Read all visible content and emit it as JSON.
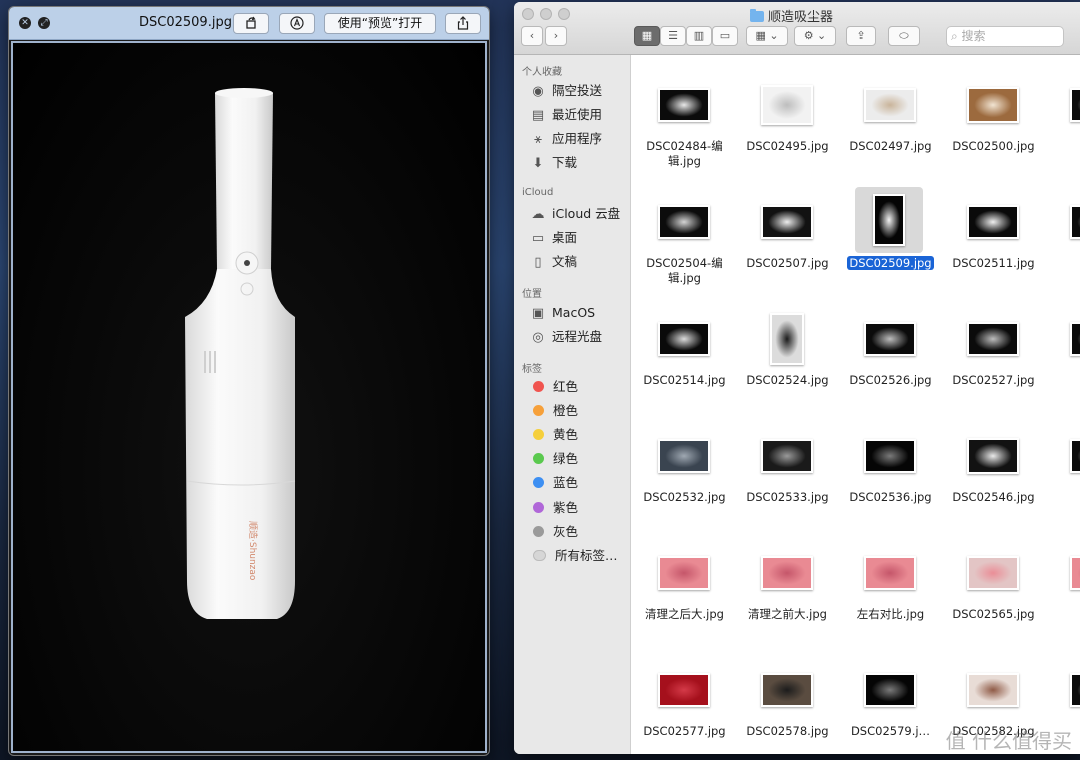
{
  "quicklook": {
    "filename": "DSC02509.jpg",
    "open_with_label": "使用“预览”打开",
    "product": {
      "brand_text": "顺造·Shunzao",
      "colors": {
        "body": "#f4f4f4",
        "background": "#000000"
      }
    }
  },
  "finder": {
    "title": "顺造吸尘器",
    "search_placeholder": "搜索",
    "sidebar": {
      "favorites_header": "个人收藏",
      "favorites": [
        {
          "label": "隔空投送",
          "icon": "airdrop-icon"
        },
        {
          "label": "最近使用",
          "icon": "recents-icon"
        },
        {
          "label": "应用程序",
          "icon": "applications-icon"
        },
        {
          "label": "下载",
          "icon": "downloads-icon"
        }
      ],
      "icloud_header": "iCloud",
      "icloud": [
        {
          "label": "iCloud 云盘",
          "icon": "cloud-icon"
        },
        {
          "label": "桌面",
          "icon": "desktop-icon"
        },
        {
          "label": "文稿",
          "icon": "documents-icon"
        }
      ],
      "locations_header": "位置",
      "locations": [
        {
          "label": "MacOS",
          "icon": "disk-icon"
        },
        {
          "label": "远程光盘",
          "icon": "remote-disc-icon"
        }
      ],
      "tags_header": "标签",
      "tags": [
        {
          "label": "红色",
          "color": "#f0544f"
        },
        {
          "label": "橙色",
          "color": "#f6a03a"
        },
        {
          "label": "黄色",
          "color": "#f5cf3b"
        },
        {
          "label": "绿色",
          "color": "#5ac94e"
        },
        {
          "label": "蓝色",
          "color": "#3d8ff2"
        },
        {
          "label": "紫色",
          "color": "#b067d8"
        },
        {
          "label": "灰色",
          "color": "#9a9a9a"
        },
        {
          "label": "所有标签…",
          "color": "#d6d6d6"
        }
      ]
    },
    "files": [
      {
        "name": "DSC02484-编辑.jpg",
        "tone": "dark"
      },
      {
        "name": "DSC02495.jpg",
        "tone": "light-box"
      },
      {
        "name": "DSC02497.jpg",
        "tone": "light-wide"
      },
      {
        "name": "DSC02500.jpg",
        "tone": "brown"
      },
      {
        "name": "DSC",
        "tone": "dark"
      },
      {
        "name": "DSC02504-编辑.jpg",
        "tone": "dark-parts"
      },
      {
        "name": "DSC02507.jpg",
        "tone": "dark-tilt"
      },
      {
        "name": "DSC02509.jpg",
        "tone": "portrait-dark",
        "selected": true
      },
      {
        "name": "DSC02511.jpg",
        "tone": "dark-bottle"
      },
      {
        "name": "DS",
        "tone": "dark"
      },
      {
        "name": "DSC02514.jpg",
        "tone": "dark-tube"
      },
      {
        "name": "DSC02524.jpg",
        "tone": "portrait-light"
      },
      {
        "name": "DSC02526.jpg",
        "tone": "dark-round"
      },
      {
        "name": "DSC02527.jpg",
        "tone": "dark-round"
      },
      {
        "name": "DS",
        "tone": "dark"
      },
      {
        "name": "DSC02532.jpg",
        "tone": "slate"
      },
      {
        "name": "DSC02533.jpg",
        "tone": "dark-ring"
      },
      {
        "name": "DSC02536.jpg",
        "tone": "black-cup"
      },
      {
        "name": "DSC02546.jpg",
        "tone": "dark-bottle-wide"
      },
      {
        "name": "DS",
        "tone": "dark"
      },
      {
        "name": "清理之后大.jpg",
        "tone": "pink"
      },
      {
        "name": "清理之前大.jpg",
        "tone": "pink"
      },
      {
        "name": "左右对比.jpg",
        "tone": "pink"
      },
      {
        "name": "DSC02565.jpg",
        "tone": "pink-light"
      },
      {
        "name": "DS",
        "tone": "pink"
      },
      {
        "name": "DSC02577.jpg",
        "tone": "red"
      },
      {
        "name": "DSC02578.jpg",
        "tone": "brown-dark"
      },
      {
        "name": "DSC02579.j…",
        "tone": "black-cup"
      },
      {
        "name": "DSC02582.jpg",
        "tone": "beige"
      },
      {
        "name": "",
        "tone": "dark"
      }
    ]
  },
  "watermark": "值 什么值得买"
}
